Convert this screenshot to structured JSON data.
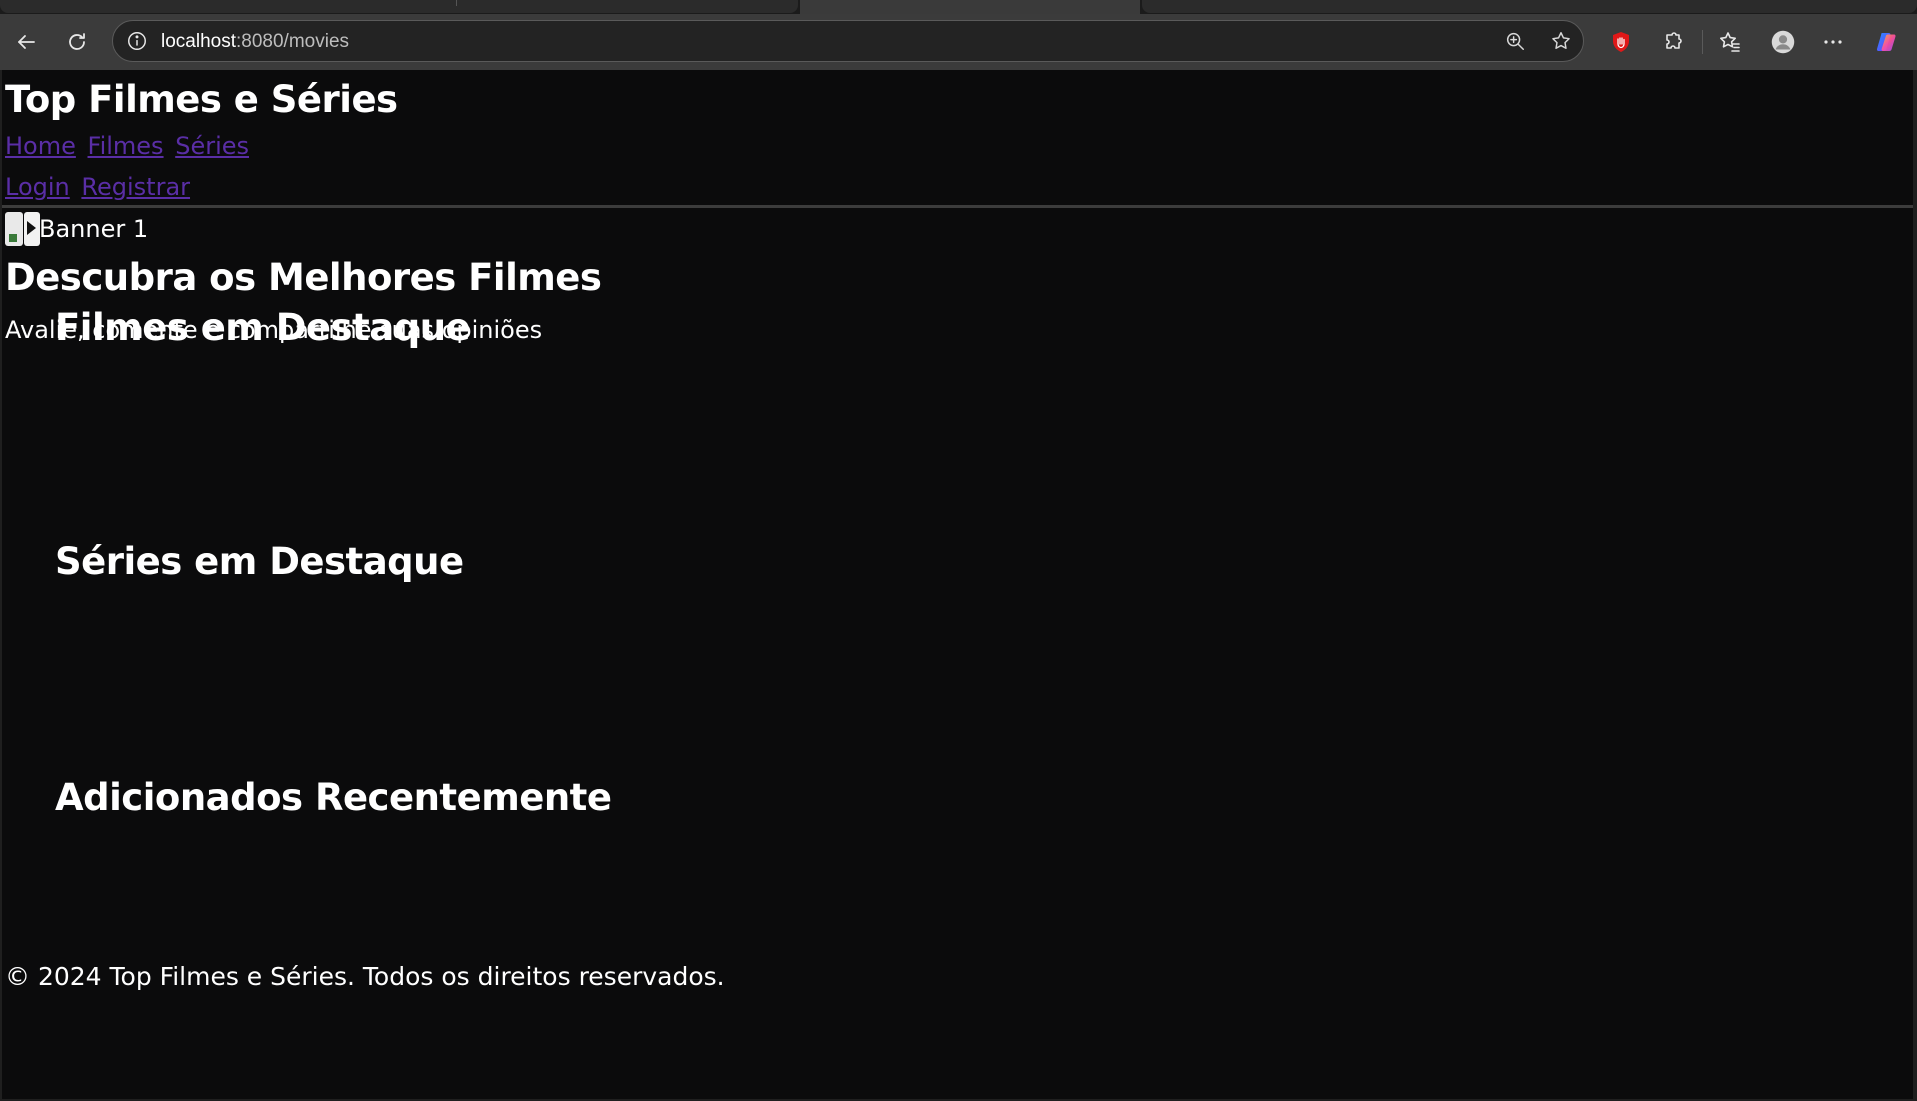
{
  "browser": {
    "url_host": "localhost",
    "url_rest": ":8080/movies",
    "icons": {
      "back": "back-arrow-icon",
      "reload": "reload-icon",
      "info": "info-icon",
      "zoom": "zoom-icon",
      "favorite": "star-icon",
      "extension_red": "red-extension-icon",
      "extensions": "puzzle-icon",
      "favorites": "favorites-icon",
      "profile": "profile-avatar-icon",
      "menu": "more-icon",
      "copilot": "copilot-icon"
    },
    "colors": {
      "toolbar": "#3b3b3b",
      "address_bar": "#232323",
      "page_background": "#0b0b0c",
      "link": "#5a2ea6"
    }
  },
  "page": {
    "site_title": "Top Filmes e Séries",
    "nav": {
      "home": "Home",
      "filmes": "Filmes",
      "series": "Séries",
      "login": "Login",
      "registrar": "Registrar"
    },
    "banner": {
      "image_alt": "Banner 1",
      "heading": "Descubra os Melhores Filmes",
      "subtitle": "Avalie, comente e compartilhe suas opiniões"
    },
    "sections": {
      "filmes_destaque": "Filmes em Destaque",
      "series_destaque": "Séries em Destaque",
      "recentes": "Adicionados Recentemente"
    },
    "footer": "© 2024 Top Filmes e Séries. Todos os direitos reservados."
  }
}
